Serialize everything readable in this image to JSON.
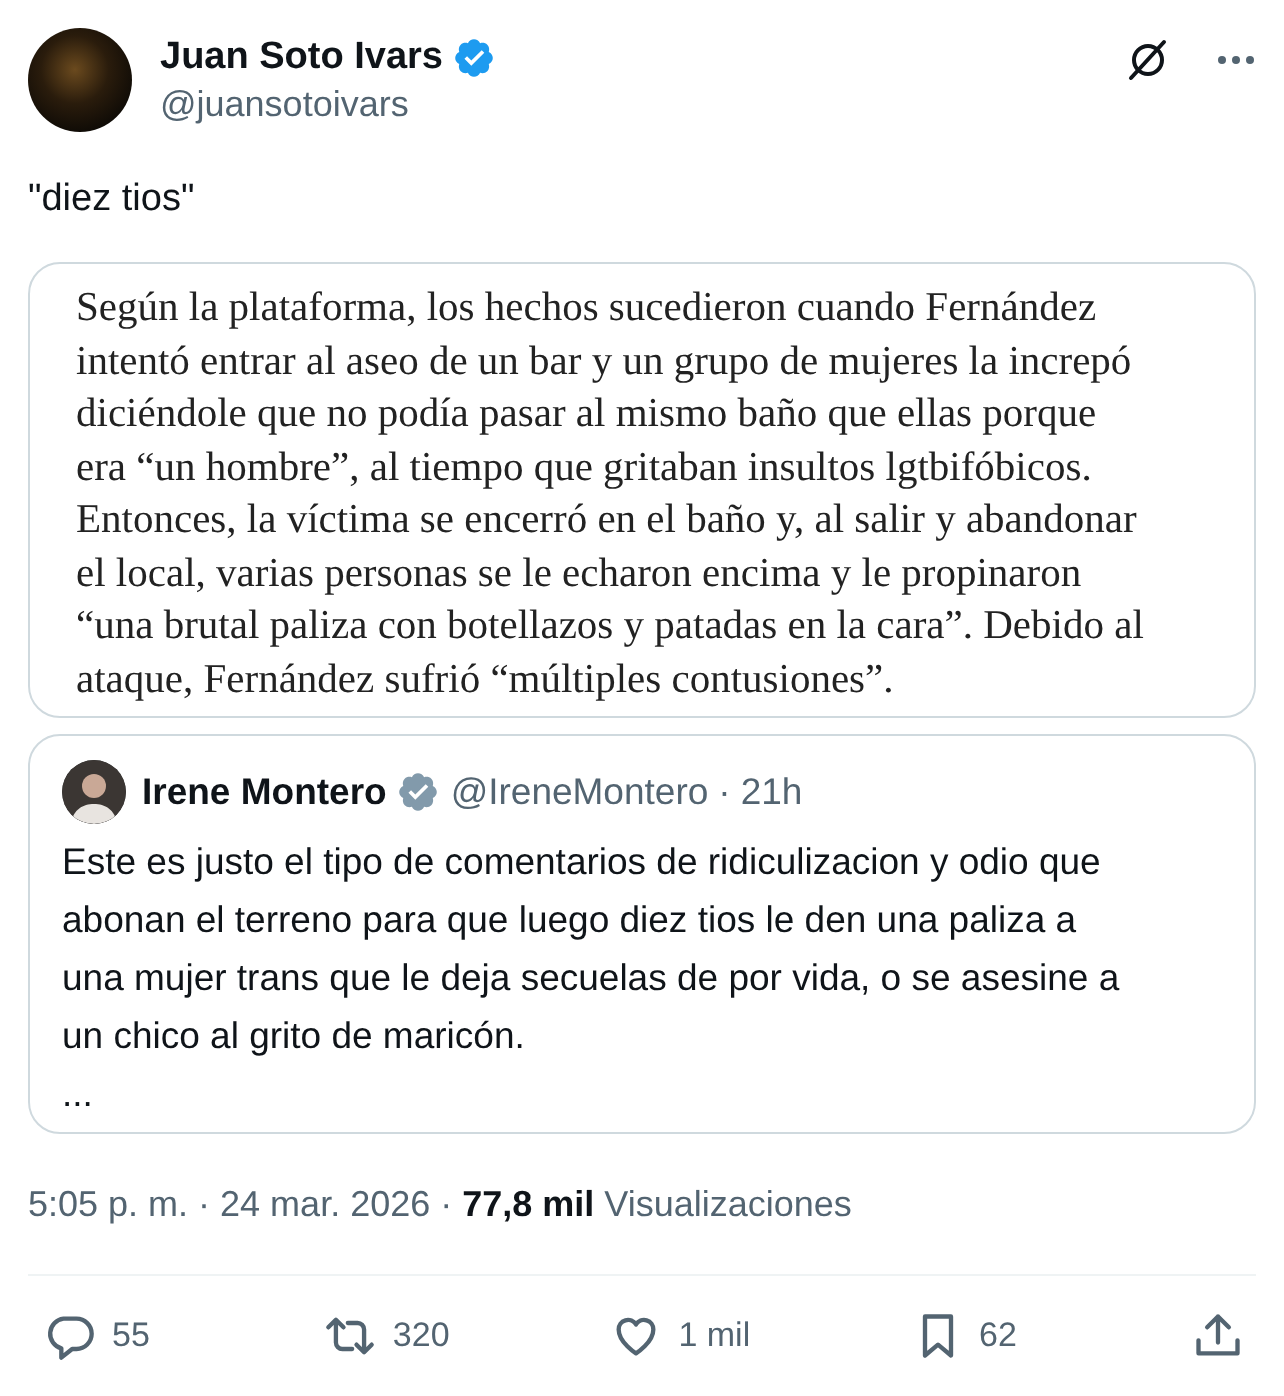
{
  "author": {
    "name": "Juan Soto Ivars",
    "verified": true,
    "handle": "@juansotoivars"
  },
  "text": "\"diez tios\"",
  "article_image": {
    "lines": [
      "Según la plataforma, los hechos sucedieron cuando Fernández",
      "intentó entrar al aseo de un bar y un grupo de mujeres la increpó",
      "diciéndole que no podía pasar al mismo baño que ellas porque",
      "era “un hombre”, al tiempo que gritaban insultos lgtbifóbicos.",
      "Entonces, la víctima se encerró en el baño y, al salir y abandonar",
      "el local, varias personas se le echaron encima y le propinaron",
      "“una brutal paliza con botellazos y patadas en la cara”. Debido al",
      "ataque, Fernández sufrió “múltiples contusiones”."
    ]
  },
  "quoted_post": {
    "name": "Irene Montero",
    "verified": true,
    "handle": "@IreneMontero",
    "separator": "·",
    "time": "21h",
    "lines": [
      "Este es justo el tipo de comentarios de ridiculizacion y odio que",
      "abonan el terreno para que luego diez tios le den una paliza a",
      "una mujer trans que le deja secuelas de por vida, o se asesine a",
      "un chico al grito de maricón.",
      "..."
    ]
  },
  "meta": "5:05 p. m. · 24 mar. 2026 · **77,8 mil** Visualizaciones",
  "actions": [
    {
      "kind": "reply",
      "count": "55"
    },
    {
      "kind": "repost",
      "count": "320"
    },
    {
      "kind": "like",
      "count": "1 mil"
    },
    {
      "kind": "bookmark",
      "count": "62"
    },
    {
      "kind": "share"
    }
  ]
}
